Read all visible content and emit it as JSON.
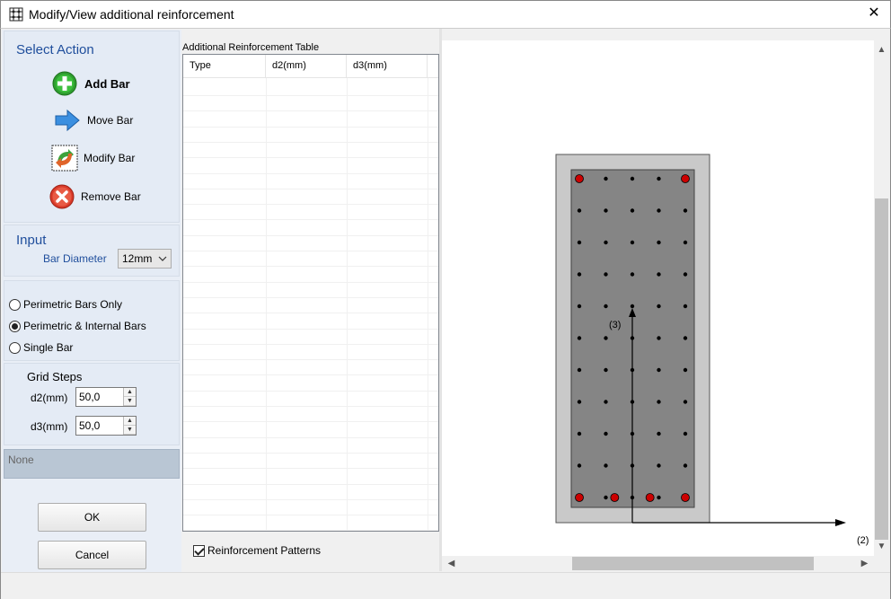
{
  "window": {
    "title": "Modify/View additional reinforcement",
    "close_glyph": "✕"
  },
  "actions": {
    "section_title": "Select Action",
    "add_bar": "Add Bar",
    "move_bar": "Move Bar",
    "modify_bar": "Modify Bar",
    "remove_bar": "Remove Bar"
  },
  "input": {
    "section_title": "Input",
    "bar_diameter_label": "Bar Diameter",
    "bar_diameter_value": "12mm"
  },
  "bar_mode": {
    "options": [
      "Perimetric Bars Only",
      "Perimetric & Internal Bars",
      "Single Bar"
    ],
    "selected": "Perimetric & Internal Bars"
  },
  "grid_steps": {
    "title": "Grid Steps",
    "d2_label": "d2(mm)",
    "d2_value": "50,0",
    "d3_label": "d3(mm)",
    "d3_value": "50,0"
  },
  "info_box": "None",
  "buttons": {
    "ok": "OK",
    "cancel": "Cancel"
  },
  "table": {
    "caption": "Additional Reinforcement Table",
    "columns": [
      "Type",
      "d2(mm)",
      "d3(mm)"
    ],
    "rows": []
  },
  "reinforcement_patterns": {
    "label": "Reinforcement Patterns",
    "checked": true
  },
  "section_view": {
    "axis_3_label": "(3)",
    "axis_2_label": "(2)",
    "grid_cols": 5,
    "grid_rows": 11,
    "red_bars": [
      [
        0,
        0
      ],
      [
        4,
        0
      ],
      [
        0,
        10
      ],
      [
        4,
        10
      ]
    ],
    "extra_red_bars_bottom": 2,
    "colors": {
      "outer": "#c9c9c9",
      "core": "#858585",
      "bar": "#000000",
      "red_bar": "#cc0000"
    }
  }
}
